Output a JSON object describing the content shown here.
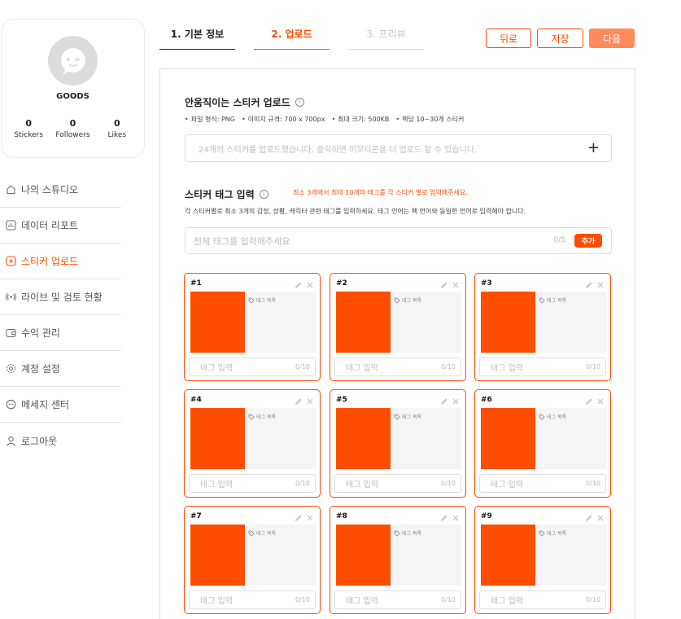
{
  "profile": {
    "name": "GOODS",
    "stats": [
      {
        "value": "0",
        "label": "Stickers"
      },
      {
        "value": "0",
        "label": "Followers"
      },
      {
        "value": "0",
        "label": "Likes"
      }
    ]
  },
  "menu": [
    {
      "label": "나의 스튜디오",
      "icon": "home-icon"
    },
    {
      "label": "데이터 리포트",
      "icon": "chart-icon"
    },
    {
      "label": "스티커 업로드",
      "icon": "plus-square-icon",
      "active": true
    },
    {
      "label": "라이브 및 검토 현황",
      "icon": "broadcast-icon"
    },
    {
      "label": "수익 관리",
      "icon": "wallet-icon"
    },
    {
      "label": "계정 설정",
      "icon": "gear-icon"
    },
    {
      "label": "메세지 센터",
      "icon": "chat-icon"
    },
    {
      "label": "로그아웃",
      "icon": "user-icon"
    }
  ],
  "steps": [
    {
      "label": "1. 기본 정보",
      "state": "done"
    },
    {
      "label": "2. 업로드",
      "state": "active"
    },
    {
      "label": "3. 프리뷰",
      "state": "disabled"
    }
  ],
  "actions": {
    "back": "뒤로",
    "save": "저장",
    "next": "다음"
  },
  "upload": {
    "title": "안움직이는 스티커 업로드",
    "specs": [
      "파일 형식: PNG",
      "이미지 규격: 700 x 700px",
      "최대 크기: 500KB",
      "팩당 10~30개 스티커"
    ],
    "placeholder": "24개의 스티커를 업로드했습니다. 클릭하면 이모티콘을 더 업로드 할 수 있습니다.",
    "plus": "+"
  },
  "tags": {
    "title": "스티커 태그 입력",
    "warning": "최소 3개에서 최대 10개의 태그를 각 스티커 별로 입력해주세요.",
    "description": "각 스티커별로 최소 3개의 감정, 상황, 캐릭터 관련 태그를 입력하세요. 태그 언어는 팩 언어와 동일한 언어로 입력해야 합니다.",
    "input_placeholder": "전체 태그를 입력해주세요",
    "count": "0/5",
    "add_label": "추가"
  },
  "stickers": [
    {
      "num": "#1",
      "tag_label": "태그 목록",
      "input_placeholder": "태그 입력",
      "count": "0/10"
    },
    {
      "num": "#2",
      "tag_label": "태그 목록",
      "input_placeholder": "태그 입력",
      "count": "0/10"
    },
    {
      "num": "#3",
      "tag_label": "태그 목록",
      "input_placeholder": "태그 입력",
      "count": "0/10"
    },
    {
      "num": "#4",
      "tag_label": "태그 목록",
      "input_placeholder": "태그 입력",
      "count": "0/10"
    },
    {
      "num": "#5",
      "tag_label": "태그 목록",
      "input_placeholder": "태그 입력",
      "count": "0/10"
    },
    {
      "num": "#6",
      "tag_label": "태그 목록",
      "input_placeholder": "태그 입력",
      "count": "0/10"
    },
    {
      "num": "#7",
      "tag_label": "태그 목록",
      "input_placeholder": "태그 입력",
      "count": "0/10"
    },
    {
      "num": "#8",
      "tag_label": "태그 목록",
      "input_placeholder": "태그 입력",
      "count": "0/10"
    },
    {
      "num": "#9",
      "tag_label": "태그 목록",
      "input_placeholder": "태그 입력",
      "count": "0/10"
    }
  ],
  "colors": {
    "accent": "#ff4d00",
    "accent_light": "#ff8a5c",
    "placeholder_image": "#ff4d00"
  }
}
